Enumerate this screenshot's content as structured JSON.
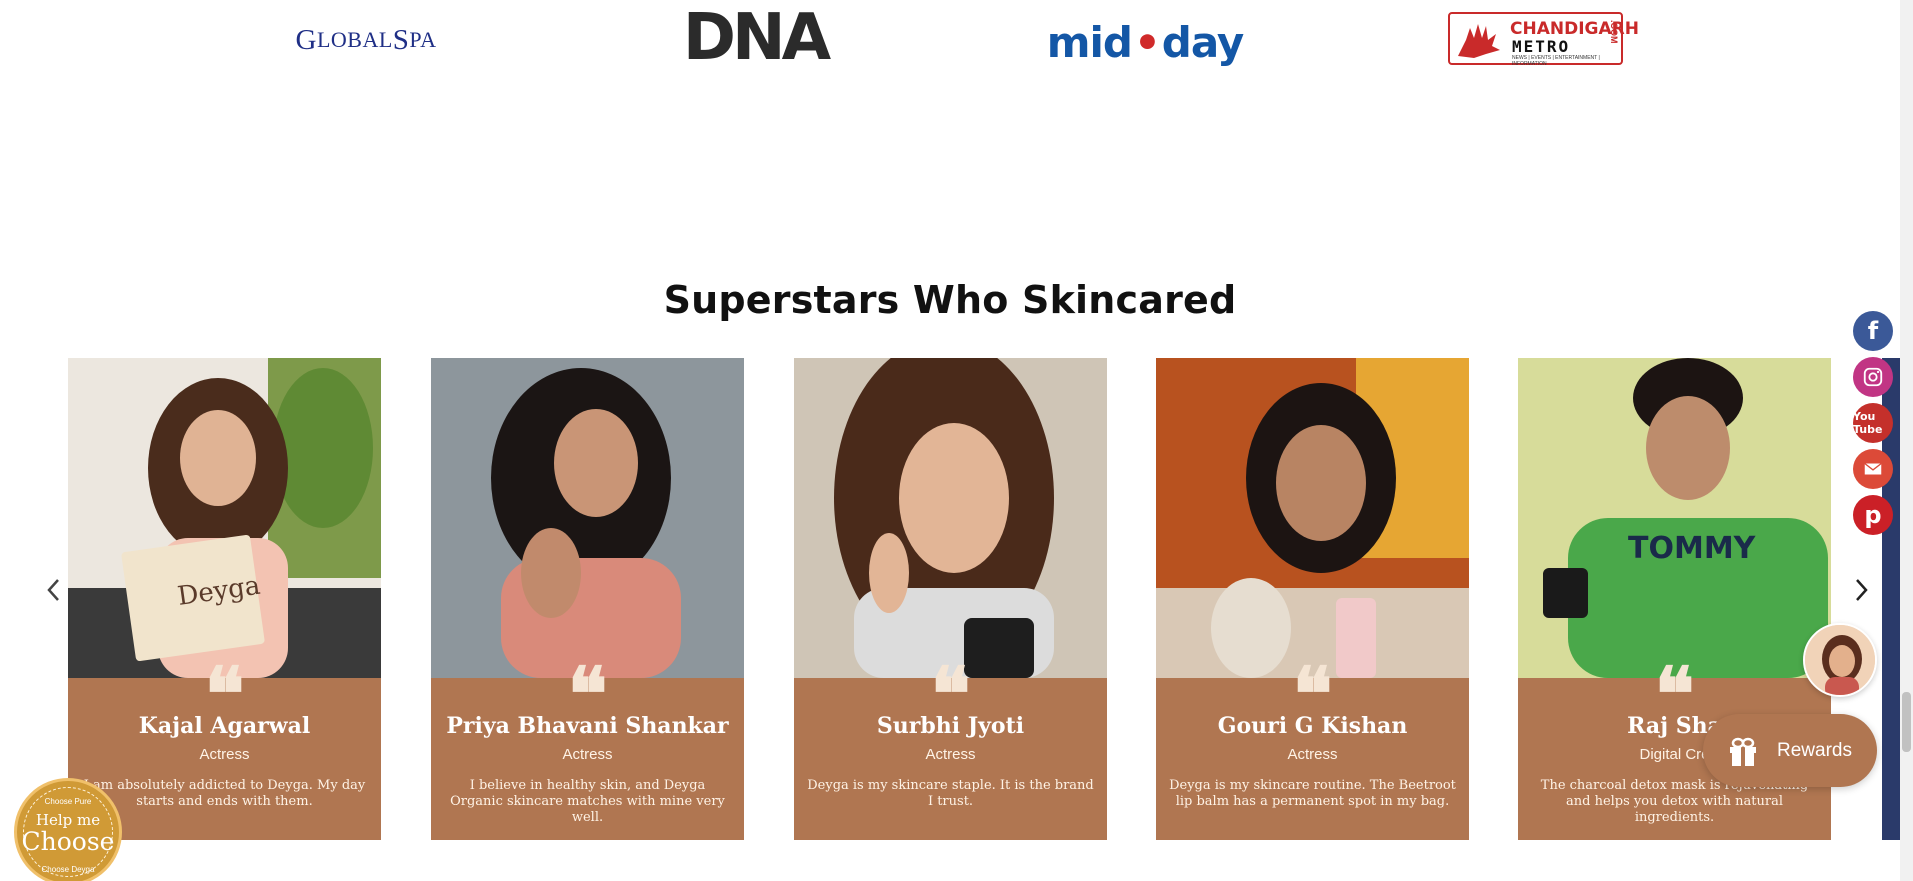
{
  "press_logos": [
    {
      "name": "GlobalSpa",
      "first": "G",
      "rest_1": "LOBAL",
      "second": "S",
      "rest_2": "PA"
    },
    {
      "name": "DNA",
      "text": "DNA"
    },
    {
      "name": "mid-day",
      "left": "mid",
      "dot": "•",
      "right": "day"
    },
    {
      "name": "Chandigarh Metro",
      "line1": "CHANDIGARH",
      "line2": "METRO",
      "line3": "NEWS | EVENTS | ENTERTAINMENT | INFORMATION",
      "suffix": ".COM"
    }
  ],
  "section": {
    "title": "Superstars Who Skincared"
  },
  "cards": [
    {
      "name": "Kajal Agarwal",
      "role": "Actress",
      "quote": "I am absolutely addicted to Deyga. My day starts and ends with them."
    },
    {
      "name": "Priya Bhavani Shankar",
      "role": "Actress",
      "quote": "I believe in healthy skin, and Deyga Organic skincare matches with mine very well."
    },
    {
      "name": "Surbhi Jyoti",
      "role": "Actress",
      "quote": "Deyga is my skincare staple. It is the brand I trust."
    },
    {
      "name": "Gouri G Kishan",
      "role": "Actress",
      "quote": "Deyga is my skincare routine. The Beetroot lip balm has a permanent spot in my bag."
    },
    {
      "name": "Raj Sha",
      "role": "Digital Cre",
      "quote": "The charcoal detox mask is rejuvenating and helps you detox with natural ingredients."
    }
  ],
  "quote_mark": "❝",
  "social": {
    "facebook": "f",
    "youtube": "You Tube",
    "pinterest": "p"
  },
  "help_badge": {
    "top": "Choose Pure",
    "line1": "Help me",
    "line2": "Choose",
    "bottom": "Choose Deyga"
  },
  "rewards": {
    "label": "Rewards"
  },
  "colors": {
    "card_bg": "#b07651",
    "accent": "#b07651",
    "badge": "#d09a36"
  }
}
